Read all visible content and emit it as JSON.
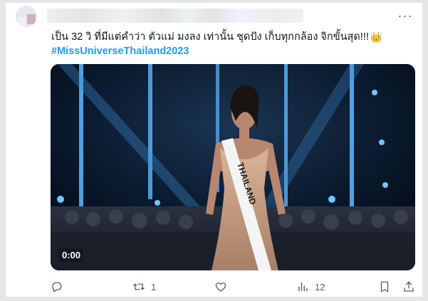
{
  "post": {
    "text_line": "เป็น 32 วิ ที่มีแต่คำว่า ตัวแม่ มงลง เท่านั้น ชุดปัง เก็บทุกกล้อง จิกขั้นสุด!!!",
    "crown_emoji": "👑",
    "hashtag": "#MissUniverseThailand2023",
    "sash_text": "THAILAND"
  },
  "video": {
    "time": "0:00"
  },
  "actions": {
    "retweet_count": "1",
    "views_count": "12"
  },
  "colors": {
    "link": "#1d9bf0",
    "icon_gray": "#536471",
    "stage_blue": "#5fb8ff"
  },
  "icons": [
    "more-icon",
    "reply-icon",
    "retweet-icon",
    "like-icon",
    "views-icon",
    "bookmark-icon",
    "share-icon"
  ]
}
